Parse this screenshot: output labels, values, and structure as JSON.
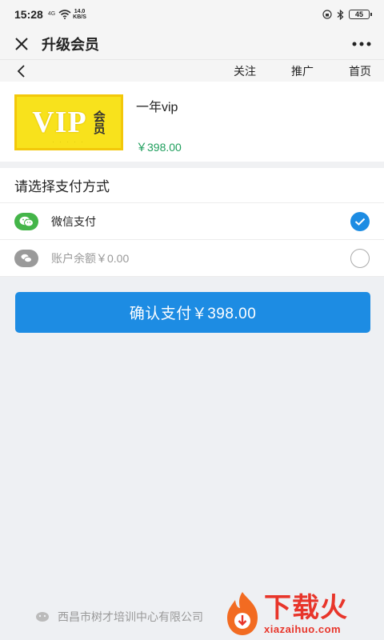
{
  "status_bar": {
    "time": "15:28",
    "network_small": "4G",
    "speed_value": "14.0",
    "speed_unit": "KB/S",
    "battery": "45"
  },
  "title_bar": {
    "title": "升级会员",
    "close_icon": "close-icon",
    "more_icon": "more-icon"
  },
  "nav_bar": {
    "back_icon": "back-icon",
    "links": [
      "关注",
      "推广",
      "首页"
    ]
  },
  "product": {
    "logo_text": "VIP",
    "logo_sub": "会员",
    "name": "一年vip",
    "price": "￥398.00"
  },
  "payment": {
    "heading": "请选择支付方式",
    "options": [
      {
        "label": "微信支付",
        "checked": true,
        "icon": "wechat-icon"
      },
      {
        "label": "账户余额￥0.00",
        "checked": false,
        "icon": "coins-icon"
      }
    ]
  },
  "confirm_button": "确认支付￥398.00",
  "footer": {
    "company": "西昌市树才培训中心有限公司"
  },
  "watermark": {
    "cn": "下载火",
    "en": "xiazaihuo.com"
  },
  "colors": {
    "accent": "#1d8ce3",
    "price_green": "#1e9e5c",
    "wechat_green": "#44b549",
    "watermark_red": "#e8352a"
  }
}
